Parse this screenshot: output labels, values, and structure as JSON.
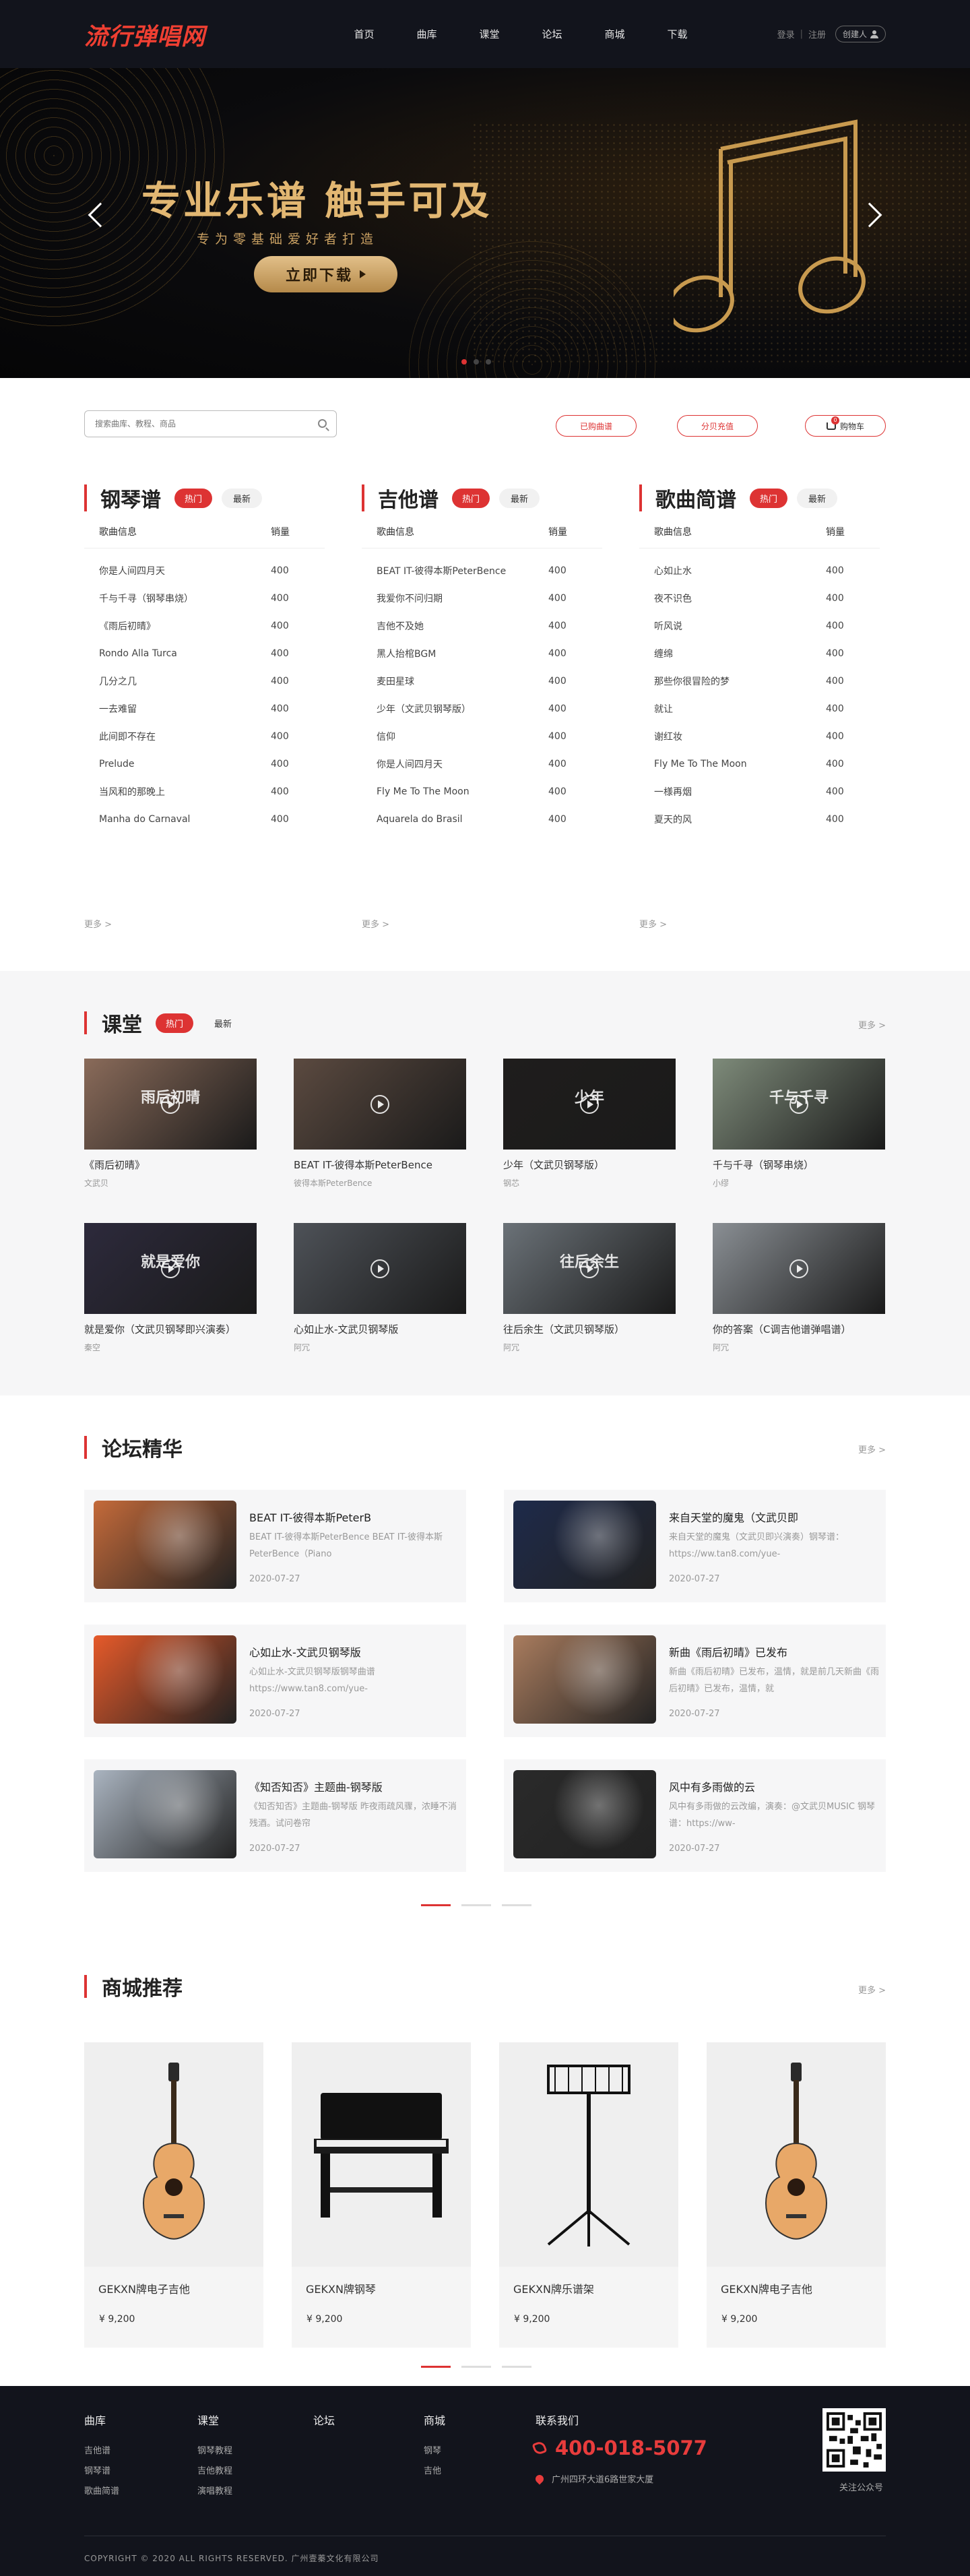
{
  "header": {
    "logo": "流行弹唱网",
    "nav": [
      "首页",
      "曲库",
      "课堂",
      "论坛",
      "商城",
      "下载"
    ],
    "login": "登录",
    "sep": "|",
    "register": "注册",
    "create": "创建人"
  },
  "banner": {
    "title": "专业乐谱 触手可及",
    "subtitle": "专为零基础爱好者打造",
    "button": "立即下载"
  },
  "tools": {
    "search_placeholder": "搜索曲库、教程、商品",
    "bought": "已购曲谱",
    "topup": "分贝充值",
    "cart": "购物车",
    "cart_count": "0"
  },
  "sheets": {
    "hot": "热门",
    "new": "最新",
    "col_song": "歌曲信息",
    "col_sales": "销量",
    "more": "更多 >",
    "columns": [
      {
        "title": "钢琴谱",
        "rows": [
          [
            "你是人间四月天",
            "400"
          ],
          [
            "千与千寻（钢琴串烧）",
            "400"
          ],
          [
            "《雨后初晴》",
            "400"
          ],
          [
            "Rondo Alla Turca",
            "400"
          ],
          [
            "几分之几",
            "400"
          ],
          [
            "一去难留",
            "400"
          ],
          [
            "此间即不存在",
            "400"
          ],
          [
            "Prelude",
            "400"
          ],
          [
            "当风和的那晚上",
            "400"
          ],
          [
            "Manha do Carnaval",
            "400"
          ]
        ]
      },
      {
        "title": "吉他谱",
        "rows": [
          [
            "BEAT IT-彼得本斯PeterBence",
            "400"
          ],
          [
            "我爱你不问归期",
            "400"
          ],
          [
            "吉他不及她",
            "400"
          ],
          [
            "黑人抬棺BGM",
            "400"
          ],
          [
            "麦田星球",
            "400"
          ],
          [
            "少年（文武贝钢琴版）",
            "400"
          ],
          [
            "信仰",
            "400"
          ],
          [
            "你是人间四月天",
            "400"
          ],
          [
            "Fly Me To The Moon",
            "400"
          ],
          [
            "Aquarela do Brasil",
            "400"
          ]
        ]
      },
      {
        "title": "歌曲简谱",
        "rows": [
          [
            "心如止水",
            "400"
          ],
          [
            "夜不识色",
            "400"
          ],
          [
            "听风说",
            "400"
          ],
          [
            "缠绵",
            "400"
          ],
          [
            "那些你很冒险的梦",
            "400"
          ],
          [
            "就让",
            "400"
          ],
          [
            "谢红妆",
            "400"
          ],
          [
            "Fly Me To The Moon",
            "400"
          ],
          [
            "一様再烟",
            "400"
          ],
          [
            "夏天的风",
            "400"
          ]
        ]
      }
    ]
  },
  "course": {
    "title": "课堂",
    "hot": "热门",
    "new": "最新",
    "more": "更多 >",
    "videos": [
      {
        "title": "《雨后初晴》",
        "author": "文武贝",
        "cap": "雨后初晴",
        "bg": "#8a6b5a"
      },
      {
        "title": "BEAT IT-彼得本斯PeterBence",
        "author": "彼得本斯PeterBence",
        "cap": "",
        "bg": "#5b4a40"
      },
      {
        "title": "少年（文武贝钢琴版）",
        "author": "钢芯",
        "cap": "少年",
        "bg": "#1f1d1c"
      },
      {
        "title": "千与千寻（钢琴串烧）",
        "author": "小缪",
        "cap": "千与千寻",
        "bg": "#7e8b7a"
      },
      {
        "title": "就是爱你（文武贝钢琴即兴演奏）",
        "author": "秦空",
        "cap": "就是爱你",
        "bg": "#2d2a3c"
      },
      {
        "title": "心如止水-文武贝钢琴版",
        "author": "阿冗",
        "cap": "",
        "bg": "#4e5258"
      },
      {
        "title": "往后余生（文武贝钢琴版）",
        "author": "阿冗",
        "cap": "往后余生",
        "bg": "#6b7278"
      },
      {
        "title": "你的答案（C调吉他谱弹唱谱）",
        "author": "阿冗",
        "cap": "",
        "bg": "#8a8f94"
      }
    ]
  },
  "forum": {
    "title": "论坛精华",
    "more": "更多 >",
    "posts": [
      {
        "title": "BEAT IT-彼得本斯PeterB",
        "desc": "BEAT IT-彼得本斯PeterBence BEAT IT-彼得本斯PeterBence（Piano",
        "date": "2020-07-27",
        "bg": "#c46a3a"
      },
      {
        "title": "来自天堂的魔鬼（文武贝即",
        "desc": "来自天堂的魔鬼（文武贝即兴演奏）钢琴谱：https://ww.tan8.com/yue-",
        "date": "2020-07-27",
        "bg": "#1e2a4a"
      },
      {
        "title": "心如止水-文武贝钢琴版",
        "desc": "心如止水-文武贝钢琴版钢琴曲谱 https://www.tan8.com/yue-",
        "date": "2020-07-27",
        "bg": "#e65a2a"
      },
      {
        "title": "新曲《雨后初晴》已发布",
        "desc": "新曲《雨后初晴》已发布，温情，就是前几天新曲《雨后初晴》已发布，温情，就",
        "date": "2020-07-27",
        "bg": "#a97c5e"
      },
      {
        "title": "《知否知否》主题曲-钢琴版",
        "desc": "《知否知否》主题曲-钢琴版 昨夜雨疏风骤，浓睡不消残酒。试问卷帘",
        "date": "2020-07-27",
        "bg": "#aab4c0"
      },
      {
        "title": "风中有多雨做的云",
        "desc": "风中有多雨做的云改编，演奏：@文武贝MUSIC 钢琴谱：https://ww-",
        "date": "2020-07-27",
        "bg": "#2a2a2a"
      }
    ]
  },
  "shop": {
    "title": "商城推荐",
    "more": "更多 >",
    "products": [
      {
        "name": "GEKXN牌电子吉他",
        "price": "¥  9,200",
        "kind": "guitar"
      },
      {
        "name": "GEKXN牌钢琴",
        "price": "¥  9,200",
        "kind": "piano"
      },
      {
        "name": "GEKXN牌乐谱架",
        "price": "¥  9,200",
        "kind": "stand"
      },
      {
        "name": "GEKXN牌电子吉他",
        "price": "¥  9,200",
        "kind": "guitar"
      }
    ]
  },
  "footer": {
    "cols": [
      {
        "title": "曲库",
        "links": [
          "吉他谱",
          "钢琴谱",
          "歌曲简谱"
        ]
      },
      {
        "title": "课堂",
        "links": [
          "钢琴教程",
          "吉他教程",
          "演唱教程"
        ]
      },
      {
        "title": "论坛",
        "links": []
      },
      {
        "title": "商城",
        "links": [
          "钢琴",
          "吉他"
        ]
      }
    ],
    "contact_title": "联系我们",
    "phone": "400-018-5077",
    "address": "广州四环大道6路世家大厦",
    "qr_label": "关注公众号",
    "copyright": "COPYRIGHT © 2020 ALL RIGHTS RESERVED. 广州壹蓁文化有限公司"
  },
  "colors": {
    "accent": "#dd3333",
    "dark": "#12141c",
    "gold": "#e2b772"
  }
}
